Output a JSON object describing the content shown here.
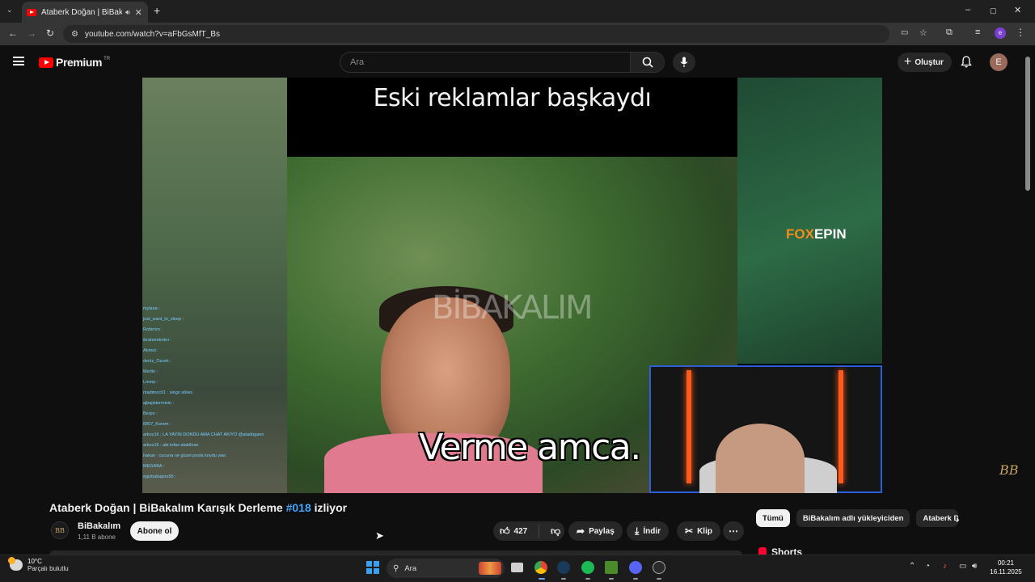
{
  "browser": {
    "tab_title": "Ataberk Doğan | BiBakalım ...",
    "url": "youtube.com/watch?v=aFbGsMfT_Bs",
    "window_controls": [
      "–",
      "▢",
      "✕"
    ]
  },
  "youtube": {
    "brand": "Premium",
    "country": "TR",
    "search_placeholder": "Ara",
    "create_label": "Oluştur",
    "avatar_letter": "E"
  },
  "video": {
    "overlay_title": "Eski reklamlar başkaydı",
    "subtitle": "Verme amca.",
    "watermark": "BİBAKALIM",
    "sponsor_a": "FOX",
    "sponsor_b": "EPIN",
    "corner_logo": "BB",
    "chat": [
      "mylana : ",
      "just_want_to_sleep : ",
      "Rohirrim : ",
      "ibrahimdmbrr : ",
      "Ahmet : ",
      "deniz_Ozcek : ",
      "Merlin : ",
      "Lmmp : ",
      "ntadimcc01 : singo sikles",
      "ajbajistermisin : ",
      "Berpo : ",
      "8907_Kerem : ",
      "arkoz16 : LA YAYIN DONDU AMA CHAT AKIYO @atadogann",
      "arkoz16 : abi tofas alabiliran",
      "hakan : cucuna ne güzel posta koydu yaw",
      "MEGABA : ",
      "egizbabapiru55 : "
    ]
  },
  "meta": {
    "title_main": "Ataberk Doğan | BiBakalım Karışık Derleme ",
    "title_tag": "#018",
    "title_suffix": " izliyor",
    "channel_name": "BiBakalım",
    "channel_subs": "1,11 B abone",
    "subscribe_label": "Abone ol",
    "likes": "427",
    "share_label": "Paylaş",
    "download_label": "İndir",
    "clip_label": "Klip",
    "chips": [
      "Tümü",
      "BiBakalım adlı yükleyiciden",
      "Ataberk Do"
    ],
    "shorts_label": "Shorts"
  },
  "taskbar": {
    "temperature": "10°C",
    "weather": "Parçalı bulutlu",
    "search_label": "Ara",
    "time": "00:21",
    "date": "16.11.2025"
  },
  "colors": {
    "accent_red": "#ff0000",
    "link_blue": "#3ea6ff",
    "background": "#0f0f0f"
  }
}
